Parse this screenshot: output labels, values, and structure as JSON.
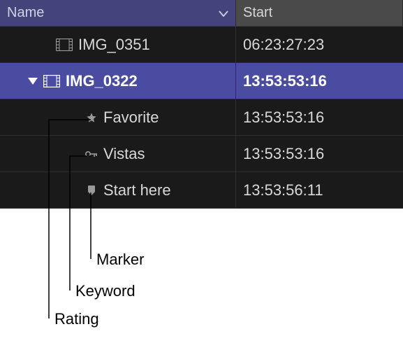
{
  "header": {
    "name_label": "Name",
    "start_label": "Start"
  },
  "rows": [
    {
      "name": "IMG_0351",
      "start": "06:23:27:23"
    },
    {
      "name": "IMG_0322",
      "start": "13:53:53:16"
    },
    {
      "name": "Favorite",
      "start": "13:53:53:16"
    },
    {
      "name": "Vistas",
      "start": "13:53:53:16"
    },
    {
      "name": "Start here",
      "start": "13:53:56:11"
    }
  ],
  "callouts": {
    "marker": "Marker",
    "keyword": "Keyword",
    "rating": "Rating"
  }
}
